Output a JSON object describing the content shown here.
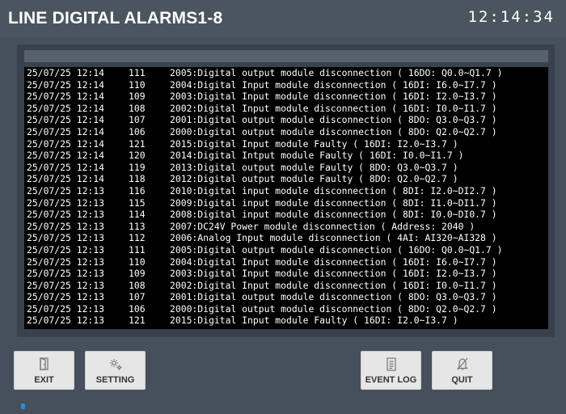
{
  "header": {
    "title": "LINE DIGITAL ALARMS1-8",
    "clock": "12:14:34"
  },
  "log": {
    "rows": [
      {
        "time": "25/07/25 12:14",
        "code": "111",
        "message": "2005:Digital output module disconnection ( 16DO: Q0.0~Q1.7 )"
      },
      {
        "time": "25/07/25 12:14",
        "code": "110",
        "message": "2004:Digital Input module disconnection ( 16DI: I6.0~I7.7 )"
      },
      {
        "time": "25/07/25 12:14",
        "code": "109",
        "message": "2003:Digital Input module disconnection ( 16DI: I2.0~I3.7 )"
      },
      {
        "time": "25/07/25 12:14",
        "code": "108",
        "message": "2002:Digital Input module disconnection ( 16DI: I0.0~I1.7 )"
      },
      {
        "time": "25/07/25 12:14",
        "code": "107",
        "message": "2001:Digital output module disconnection ( 8DO: Q3.0~Q3.7 )"
      },
      {
        "time": "25/07/25 12:14",
        "code": "106",
        "message": "2000:Digital output module disconnection ( 8DO: Q2.0~Q2.7 )"
      },
      {
        "time": "25/07/25 12:14",
        "code": "121",
        "message": "2015:Digital Input module Faulty ( 16DI: I2.0~I3.7 )"
      },
      {
        "time": "25/07/25 12:14",
        "code": "120",
        "message": "2014:Digital Intput module Faulty ( 16DI: I0.0~I1.7 )"
      },
      {
        "time": "25/07/25 12:14",
        "code": "119",
        "message": "2013:Digital output module Faulty ( 8DO: Q3.0~Q3.7 )"
      },
      {
        "time": "25/07/25 12:14",
        "code": "118",
        "message": "2012:Digital output module Faulty ( 8DO: Q2.0~Q2.7 )"
      },
      {
        "time": "25/07/25 12:13",
        "code": "116",
        "message": "2010:Digital input module disconnection ( 8DI: I2.0~DI2.7 )"
      },
      {
        "time": "25/07/25 12:13",
        "code": "115",
        "message": "2009:Digital input module disconnection ( 8DI: I1.0~DI1.7 )"
      },
      {
        "time": "25/07/25 12:13",
        "code": "114",
        "message": "2008:Digital input module disconnection ( 8DI: I0.0~DI0.7 )"
      },
      {
        "time": "25/07/25 12:13",
        "code": "113",
        "message": "2007:DC24V Power module disconnection ( Address: 2040 )"
      },
      {
        "time": "25/07/25 12:13",
        "code": "112",
        "message": "2006:Analog Input module disconnection ( 4AI: AI320~AI328 )"
      },
      {
        "time": "25/07/25 12:13",
        "code": "111",
        "message": "2005:Digital output module disconnection ( 16DO: Q0.0~Q1.7 )"
      },
      {
        "time": "25/07/25 12:13",
        "code": "110",
        "message": "2004:Digital Input module disconnection ( 16DI: I6.0~I7.7 )"
      },
      {
        "time": "25/07/25 12:13",
        "code": "109",
        "message": "2003:Digital Input module disconnection ( 16DI: I2.0~I3.7 )"
      },
      {
        "time": "25/07/25 12:13",
        "code": "108",
        "message": "2002:Digital Input module disconnection ( 16DI: I0.0~I1.7 )"
      },
      {
        "time": "25/07/25 12:13",
        "code": "107",
        "message": "2001:Digital output module disconnection ( 8DO: Q3.0~Q3.7 )"
      },
      {
        "time": "25/07/25 12:13",
        "code": "106",
        "message": "2000:Digital output module disconnection ( 8DO: Q2.0~Q2.7 )"
      },
      {
        "time": "25/07/25 12:13",
        "code": "121",
        "message": "2015:Digital Input module Faulty ( 16DI: I2.0~I3.7 )"
      }
    ]
  },
  "buttons": {
    "exit": {
      "label": "EXIT",
      "icon": "door-exit-icon"
    },
    "setting": {
      "label": "SETTING",
      "icon": "gear-icon"
    },
    "event_log": {
      "label": "EVENT LOG",
      "icon": "document-list-icon"
    },
    "quit": {
      "label": "QUIT",
      "icon": "bell-off-icon"
    }
  },
  "colors": {
    "background": "#45505c",
    "log_background": "#000000",
    "log_text": "#ffffff",
    "button_background": "#e6e6e6",
    "status_indicator": "#2a8fe0"
  }
}
